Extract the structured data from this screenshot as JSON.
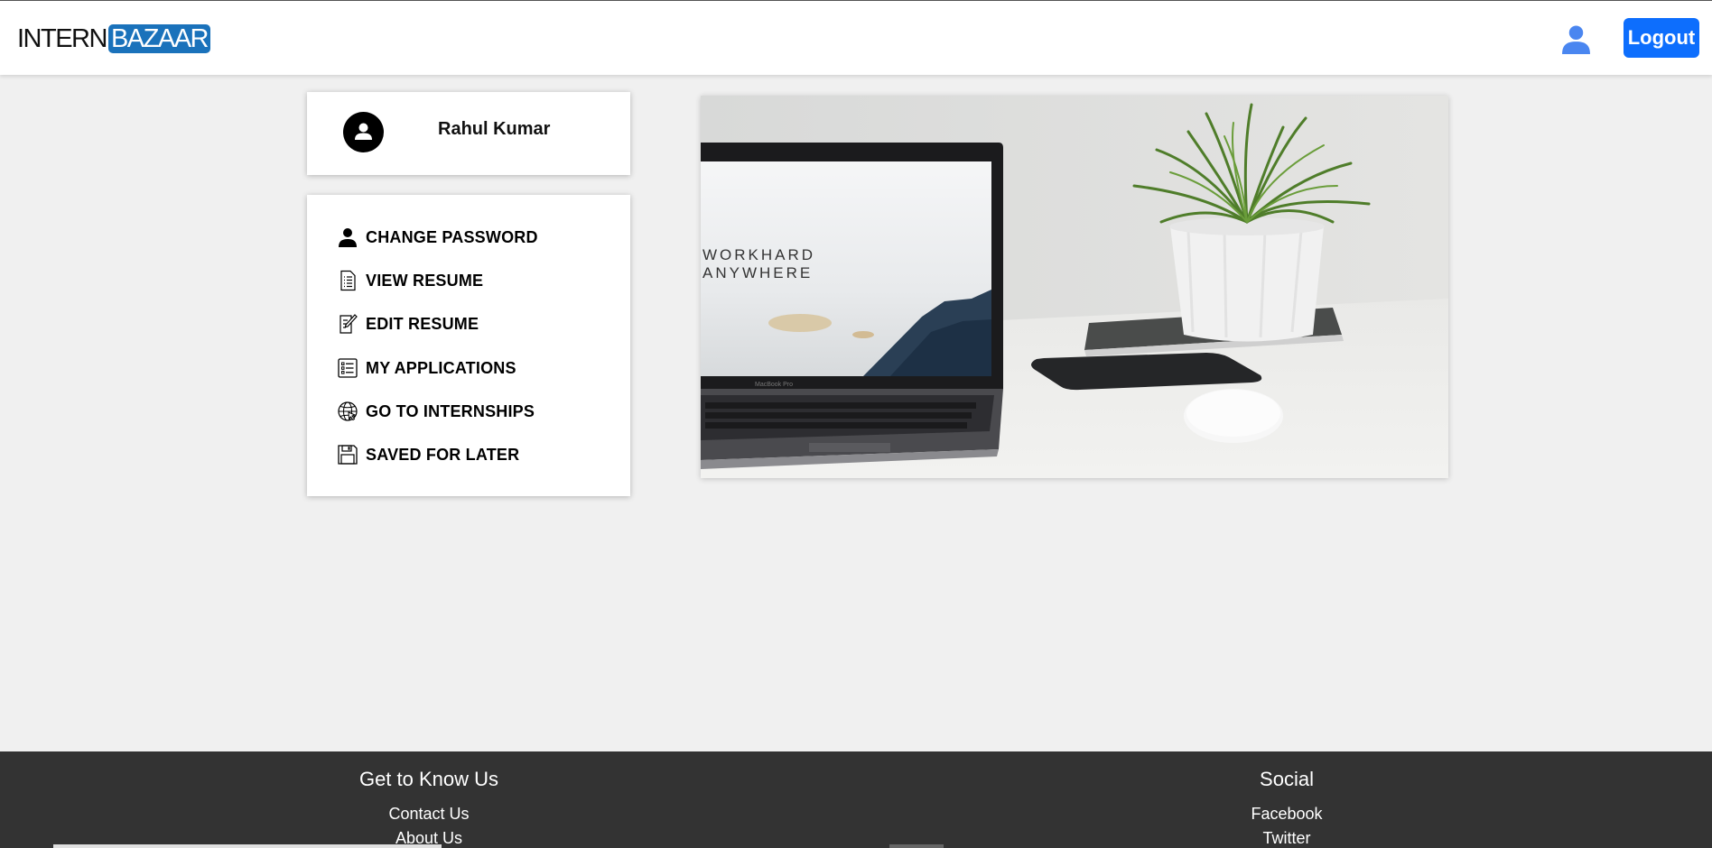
{
  "header": {
    "logo_part1": "INTERN",
    "logo_part2": "BAZAAR",
    "logout_label": "Logout",
    "brand_color": "#1a72bb",
    "button_color": "#0d6efd"
  },
  "profile": {
    "name": "Rahul Kumar"
  },
  "menu": {
    "items": [
      {
        "label": "CHANGE PASSWORD",
        "icon": "person-icon"
      },
      {
        "label": "VIEW RESUME",
        "icon": "document-icon"
      },
      {
        "label": "EDIT RESUME",
        "icon": "edit-document-icon"
      },
      {
        "label": "MY APPLICATIONS",
        "icon": "list-icon"
      },
      {
        "label": "GO TO INTERNSHIPS",
        "icon": "globe-icon"
      },
      {
        "label": "SAVED FOR LATER",
        "icon": "floppy-disk-icon"
      }
    ]
  },
  "hero": {
    "screen_text_line1": "WORKHARD",
    "screen_text_line2": "ANYWHERE",
    "laptop_brand": "MacBook Pro"
  },
  "footer": {
    "left_heading": "Get to Know Us",
    "left_links": [
      "Contact Us",
      "About Us"
    ],
    "right_heading": "Social",
    "right_links": [
      "Facebook",
      "Twitter"
    ]
  }
}
